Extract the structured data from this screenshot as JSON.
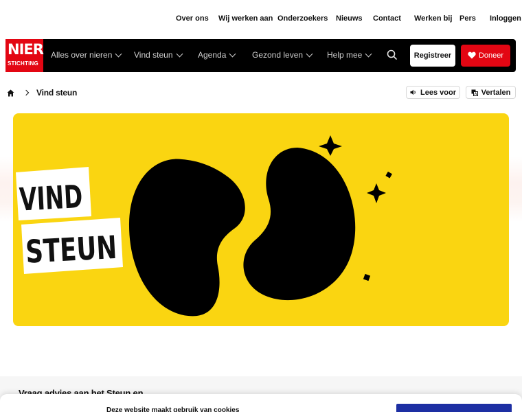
{
  "toplinks": [
    {
      "label": "Over ons"
    },
    {
      "label": "Wij werken aan"
    },
    {
      "label": "Onderzoekers"
    },
    {
      "label": "Nieuws"
    },
    {
      "label": "Contact"
    },
    {
      "label": "Werken bij"
    },
    {
      "label": "Pers"
    },
    {
      "label": "Inloggen"
    }
  ],
  "logo": {
    "big": "NIER",
    "small": "STICHTING"
  },
  "nav": {
    "items": [
      {
        "label": "Alles over nieren"
      },
      {
        "label": "Vind steun"
      },
      {
        "label": "Agenda"
      },
      {
        "label": "Gezond leven"
      },
      {
        "label": "Help mee"
      }
    ],
    "register_label": "Registreer",
    "donate_label": "Doneer"
  },
  "breadcrumb": {
    "current": "Vind steun"
  },
  "tools": {
    "read_label": "Lees voor",
    "translate_label": "Vertalen"
  },
  "hero": {
    "line1": "VIND",
    "line2": "STEUN"
  },
  "section": {
    "title": "Vraag advies aan het Steun en"
  },
  "cookie": {
    "text": "Deze website maakt gebruik van cookies"
  },
  "colors": {
    "brand_red": "#e30613",
    "hero_yellow": "#fad511",
    "accept_blue": "#1d2fa3"
  }
}
